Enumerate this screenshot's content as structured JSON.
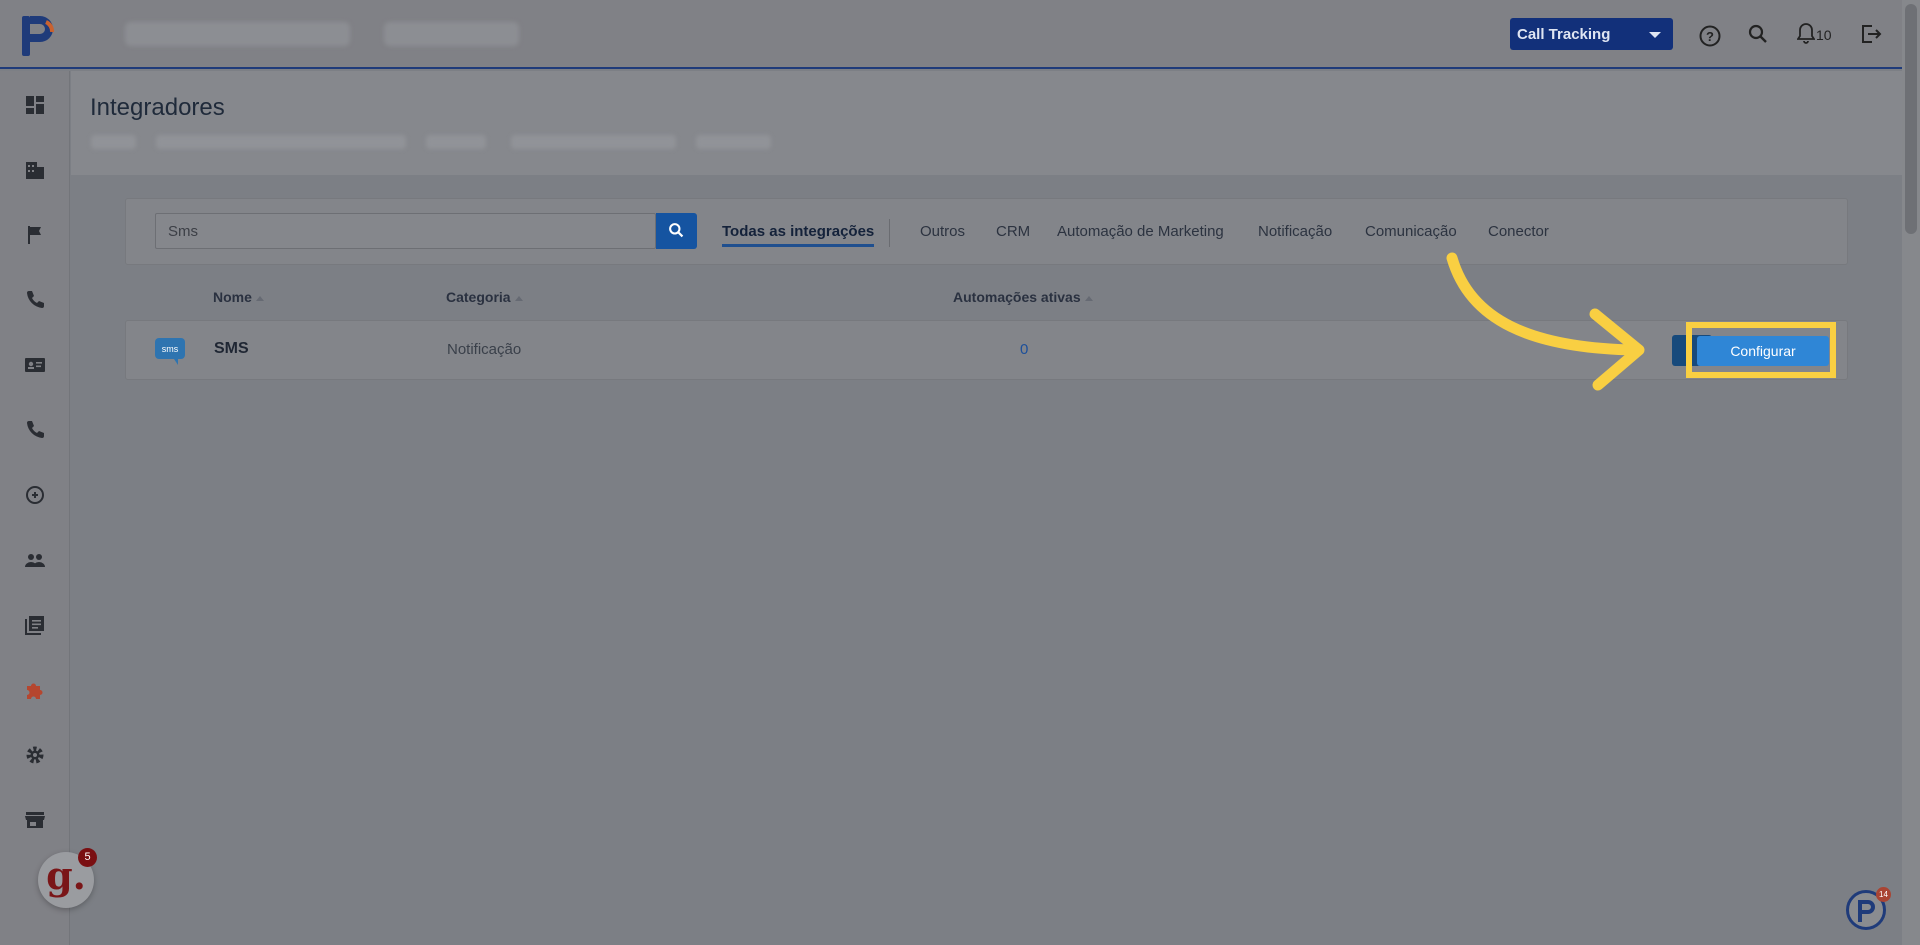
{
  "topbar": {
    "product_select": "Call Tracking",
    "notifications_count": "10"
  },
  "page": {
    "title": "Integradores"
  },
  "filters": {
    "search_value": "Sms",
    "tabs": [
      {
        "label": "Todas as integrações",
        "active": true
      },
      {
        "label": "Outros",
        "active": false
      },
      {
        "label": "CRM",
        "active": false
      },
      {
        "label": "Automação de Marketing",
        "active": false
      },
      {
        "label": "Notificação",
        "active": false
      },
      {
        "label": "Comunicação",
        "active": false
      },
      {
        "label": "Conector",
        "active": false
      }
    ]
  },
  "table": {
    "headers": {
      "name": "Nome",
      "category": "Categoria",
      "active_automations": "Automações ativas"
    },
    "rows": [
      {
        "icon_label": "sms",
        "name": "SMS",
        "category": "Notificação",
        "active_automations": "0",
        "action_label": "Configurar"
      }
    ]
  },
  "widgets": {
    "chat_letter": "g.",
    "chat_badge": "5",
    "help_badge": "14"
  },
  "colors": {
    "brand_dark": "#12307a",
    "accent_blue": "#2f86d6",
    "highlight_yellow": "#f9cf42",
    "active_sidebar_icon": "#b5462f"
  }
}
